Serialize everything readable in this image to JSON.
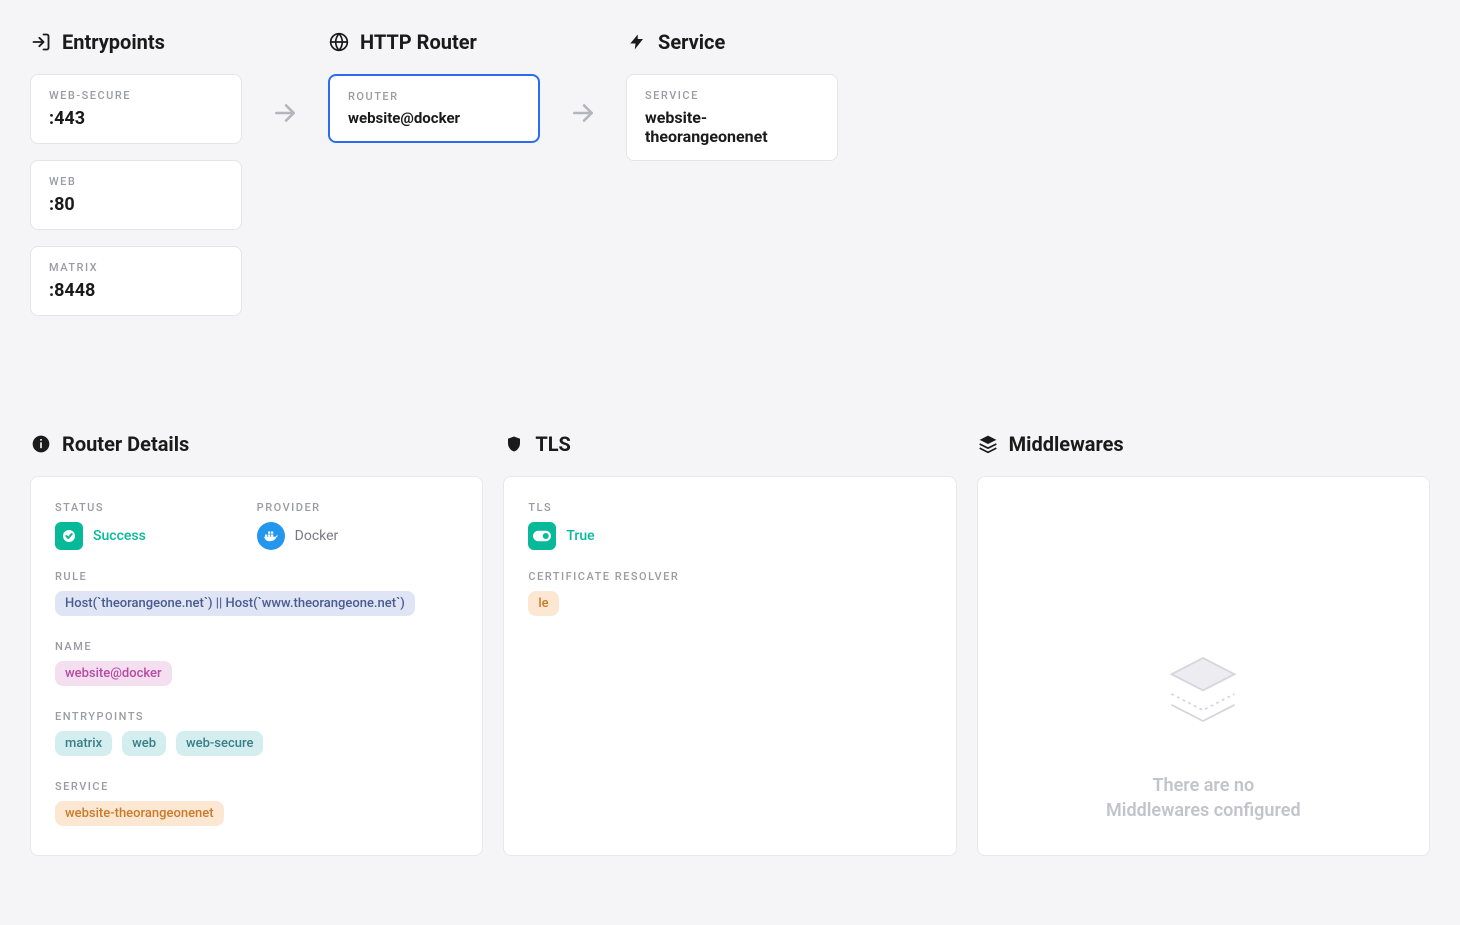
{
  "top": {
    "entrypoints": {
      "title": "Entrypoints",
      "items": [
        {
          "label": "WEB-SECURE",
          "value": ":443"
        },
        {
          "label": "WEB",
          "value": ":80"
        },
        {
          "label": "MATRIX",
          "value": ":8448"
        }
      ]
    },
    "httpRouter": {
      "title": "HTTP Router",
      "label": "ROUTER",
      "value": "website@docker"
    },
    "service": {
      "title": "Service",
      "label": "SERVICE",
      "value": "website-theorangeonenet"
    }
  },
  "routerDetails": {
    "title": "Router Details",
    "statusLabel": "STATUS",
    "statusText": "Success",
    "providerLabel": "PROVIDER",
    "providerText": "Docker",
    "ruleLabel": "RULE",
    "ruleChip": "Host(`theorangeone.net`) || Host(`www.theorangeone.net`)",
    "nameLabel": "NAME",
    "nameChip": "website@docker",
    "epLabel": "ENTRYPOINTS",
    "epChips": [
      "matrix",
      "web",
      "web-secure"
    ],
    "serviceLabel": "SERVICE",
    "serviceChip": "website-theorangeonenet"
  },
  "tls": {
    "title": "TLS",
    "tlsLabel": "TLS",
    "tlsText": "True",
    "resolverLabel": "CERTIFICATE RESOLVER",
    "resolverChip": "le"
  },
  "middlewares": {
    "title": "Middlewares",
    "emptyLine1": "There are no",
    "emptyLine2": "Middlewares configured"
  }
}
